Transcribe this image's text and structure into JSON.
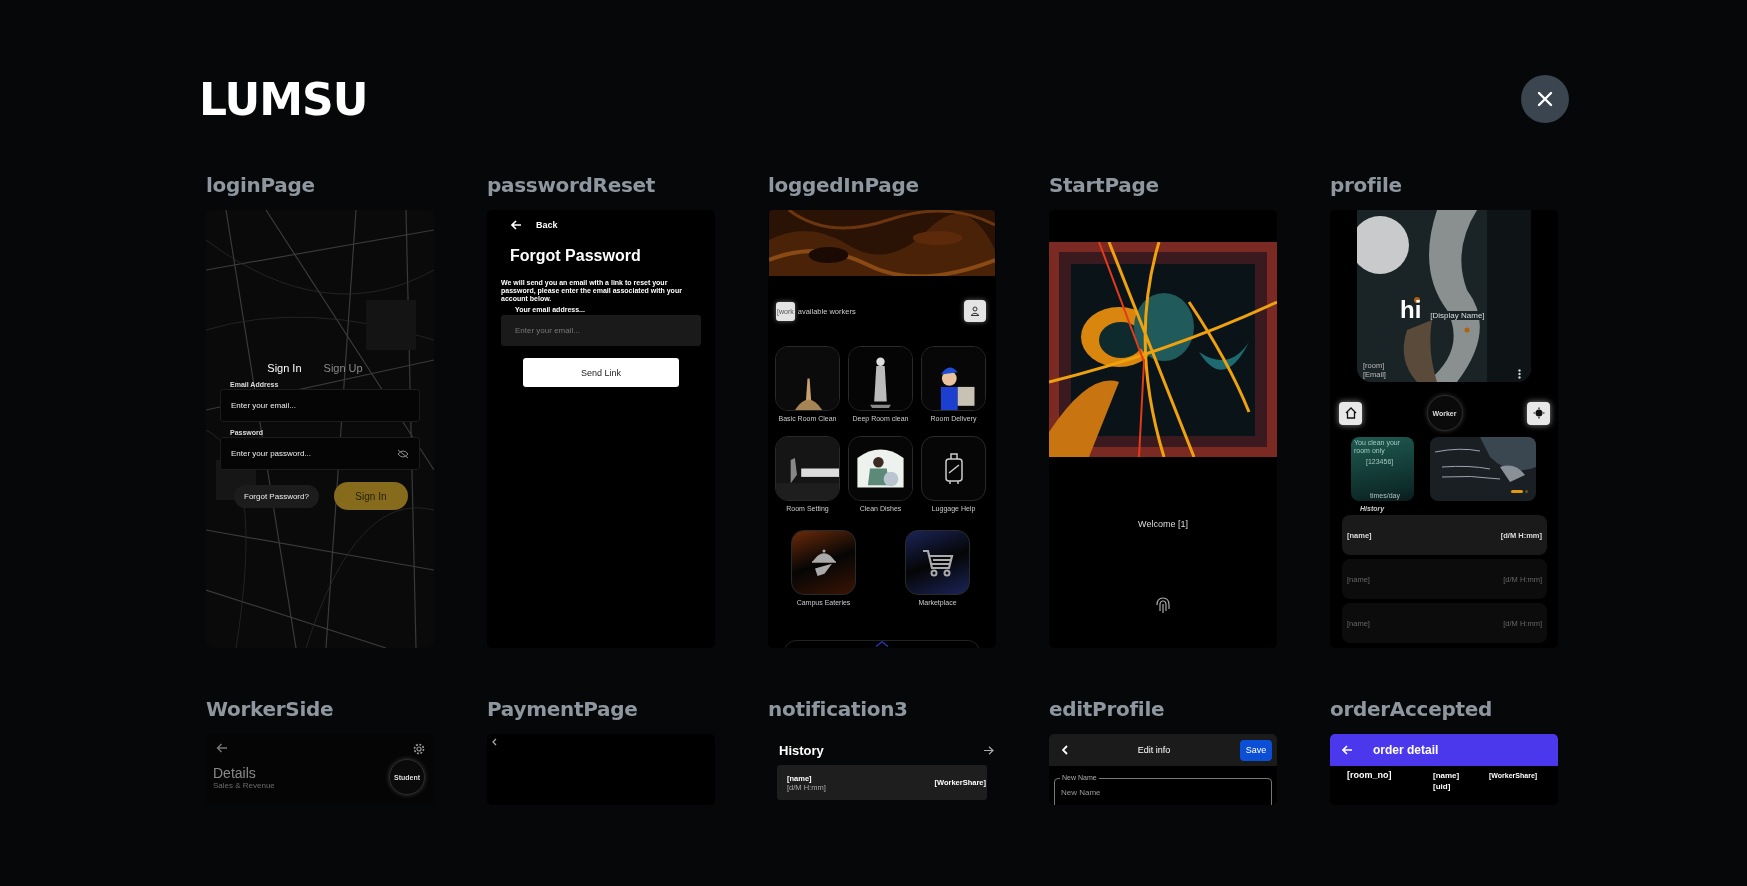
{
  "app_title": "LUMSU",
  "screens": [
    {
      "name": "loginPage",
      "kind": "login",
      "tabs": [
        {
          "label": "Sign In",
          "selected": true
        },
        {
          "label": "Sign Up",
          "selected": false
        }
      ],
      "fields": [
        {
          "label": "Email Address",
          "placeholder": "Enter your email...",
          "masked": false
        },
        {
          "label": "Password",
          "placeholder": "Enter your password...",
          "masked": true
        }
      ],
      "link_button": "Forgot Password?",
      "submit_button": "Sign In"
    },
    {
      "name": "passwordReset",
      "kind": "reset",
      "back": "Back",
      "title": "Forgot Password",
      "description": "We will send you an email with a link to reset your password, please enter the email associated with your account below.",
      "field": {
        "label": "Your email address...",
        "placeholder": "Enter your email..."
      },
      "button": "Send Link"
    },
    {
      "name": "loggedInPage",
      "kind": "home",
      "badge": "[work",
      "caption": "available workers",
      "services": [
        {
          "label": "Basic Room Clean",
          "kind": "picture"
        },
        {
          "label": "Deep Room clean",
          "kind": "picture"
        },
        {
          "label": "Room Delivery",
          "kind": "picture"
        },
        {
          "label": "Room Setting",
          "kind": "picture"
        },
        {
          "label": "Clean Dishes",
          "kind": "picture"
        },
        {
          "label": "Luggage Help",
          "kind": "icon"
        },
        {
          "label": "Campus Eateries",
          "kind": "icon"
        },
        {
          "label": "Marketplace",
          "kind": "icon"
        }
      ]
    },
    {
      "name": "StartPage",
      "kind": "start",
      "welcome": "Welcome [1]"
    },
    {
      "name": "profile",
      "kind": "profile",
      "greeting": "hi",
      "display_name": "[Display Name]",
      "room": "[room]",
      "email": "[Email]",
      "role_button": "Worker",
      "stat_card": {
        "caption": "You clean your room only",
        "value": "[123456]",
        "unit": "times/day"
      },
      "pager": [
        {
          "selected": true
        },
        {
          "selected": false
        }
      ],
      "history_title": "History",
      "history": [
        {
          "name": "[name]",
          "time": "[d/M H:mm]",
          "selected": true
        },
        {
          "name": "[name]",
          "time": "[d/M H:mm]",
          "selected": false
        },
        {
          "name": "[name]",
          "time": "[d/M H:mm]",
          "selected": false
        }
      ]
    },
    {
      "name": "WorkerSide",
      "kind": "worker",
      "title": "Details",
      "subtitle": "Sales & Revenue",
      "role_button": "Student"
    },
    {
      "name": "PaymentPage",
      "kind": "payment"
    },
    {
      "name": "notification3",
      "kind": "notification",
      "title": "History",
      "items": [
        {
          "name": "[name]",
          "time": "[d/M H:mm]",
          "share": "[WorkerShare]"
        }
      ]
    },
    {
      "name": "editProfile",
      "kind": "edit",
      "title": "Edit info",
      "save_button": "Save",
      "field": {
        "label": "New Name",
        "placeholder": "New Name"
      }
    },
    {
      "name": "orderAccepted",
      "kind": "order",
      "title": "order detail",
      "cells": [
        "[room_no]",
        "[name]",
        "[WorkerShare]",
        "[uid]"
      ]
    }
  ]
}
